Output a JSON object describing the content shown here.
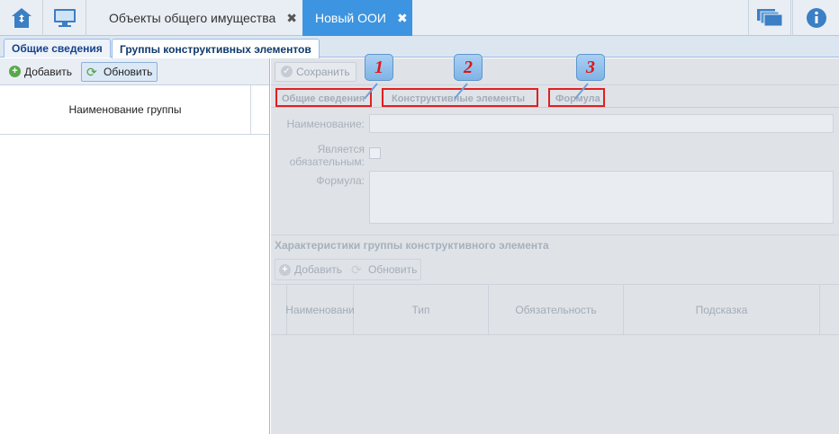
{
  "topbar": {
    "tabs": [
      {
        "label": "Объекты общего имущества",
        "close": "✖",
        "active": false
      },
      {
        "label": "Новый ООИ",
        "close": "✖",
        "active": true
      }
    ],
    "icons": [
      "home-icon",
      "monitor-icon",
      "windows-icon",
      "info-icon"
    ]
  },
  "subtabs": [
    "Общие сведения",
    "Группы конструктивных элементов"
  ],
  "left": {
    "add_label": "Добавить",
    "refresh_label": "Обновить",
    "column": "Наименование группы"
  },
  "right": {
    "save_label": "Сохранить",
    "tabs": [
      "Общие сведения",
      "Конструктивные элементы",
      "Формула"
    ],
    "callouts": [
      "1",
      "2",
      "3"
    ],
    "form": {
      "name_label": "Наименование:",
      "required_label_1": "Является",
      "required_label_2": "обязательным:",
      "formula_label": "Формула:"
    },
    "section_title": "Характеристики группы конструктивного элемента",
    "section_add": "Добавить",
    "section_refresh": "Обновить",
    "columns": [
      "Наименовани",
      "Тип",
      "Обязательность",
      "Подсказка"
    ]
  },
  "colors": {
    "accent": "#3d94e0",
    "highlight": "#e02020"
  }
}
